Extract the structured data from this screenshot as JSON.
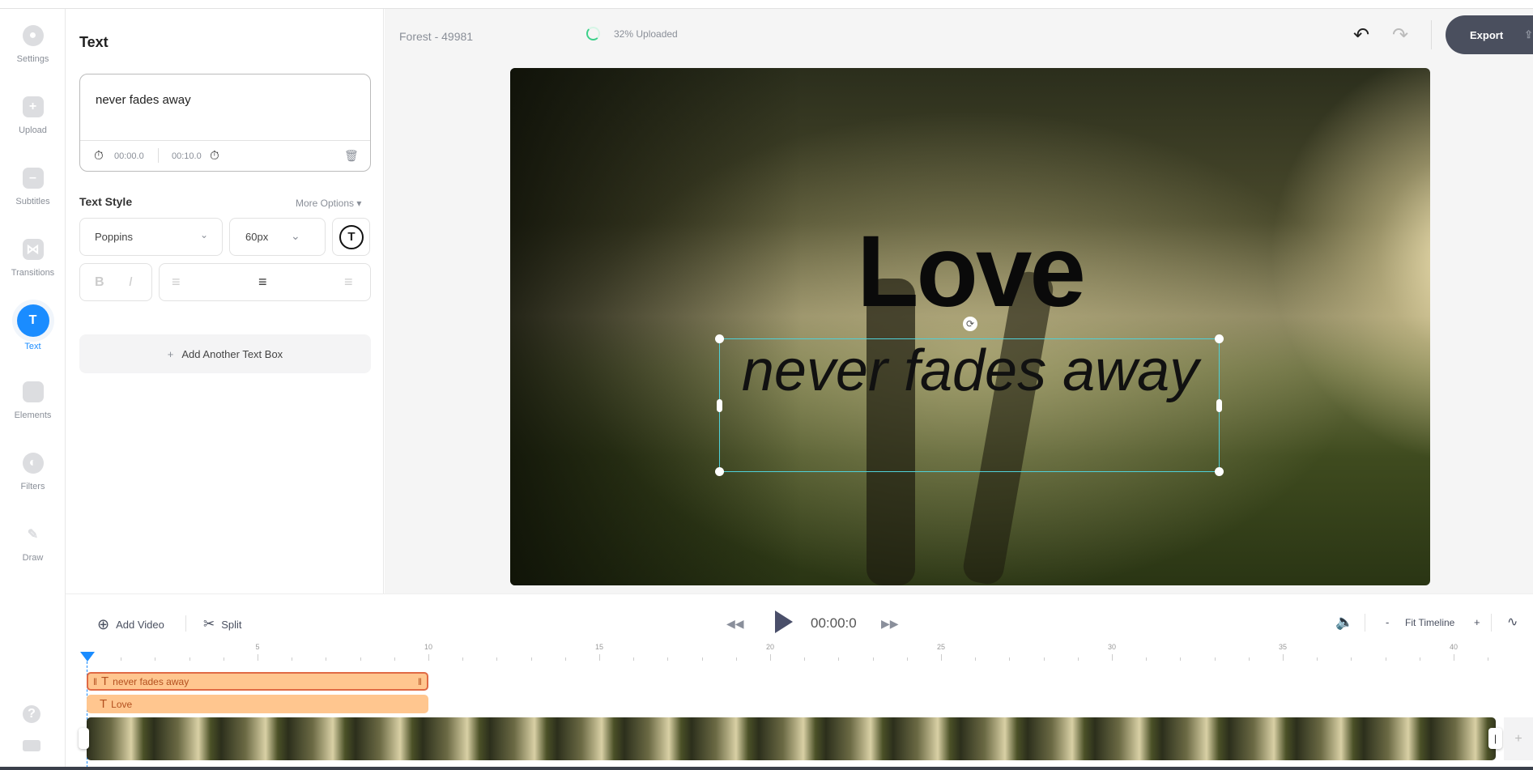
{
  "sidebar": {
    "items": [
      {
        "label": "Settings",
        "icon": "settings-icon"
      },
      {
        "label": "Upload",
        "icon": "upload-icon"
      },
      {
        "label": "Subtitles",
        "icon": "subtitles-icon"
      },
      {
        "label": "Transitions",
        "icon": "transitions-icon"
      },
      {
        "label": "Text",
        "icon": "text-icon",
        "active": true
      },
      {
        "label": "Elements",
        "icon": "elements-icon"
      },
      {
        "label": "Filters",
        "icon": "filters-icon"
      },
      {
        "label": "Draw",
        "icon": "draw-icon"
      }
    ]
  },
  "panel": {
    "title": "Text",
    "text_value": "never fades away",
    "start_time": "00:00.0",
    "end_time": "00:10.0",
    "style_title": "Text Style",
    "more_options": "More Options",
    "font": "Poppins",
    "size": "60px",
    "bold": "B",
    "italic": "I",
    "add_text_box": "Add Another Text Box"
  },
  "header": {
    "project_name": "Forest - 49981",
    "upload_status": "32% Uploaded",
    "upload_progress": 32,
    "export_label": "Export"
  },
  "canvas": {
    "title_text": "Love",
    "subtitle_text": "never fades away"
  },
  "timeline": {
    "add_video": "Add Video",
    "split": "Split",
    "time": "00:00:0",
    "fit": "Fit Timeline",
    "zoom_out": "-",
    "zoom_in": "+",
    "ticks": [
      "5",
      "10",
      "15",
      "20",
      "25",
      "30",
      "35",
      "40"
    ],
    "clips": [
      {
        "label": "never fades away",
        "start": 0,
        "end": 10
      },
      {
        "label": "Love",
        "start": 0,
        "end": 10
      }
    ]
  },
  "colors": {
    "accent": "#1a8cff",
    "clip": "#ffc68f",
    "export_bg": "#4a4f5e"
  }
}
